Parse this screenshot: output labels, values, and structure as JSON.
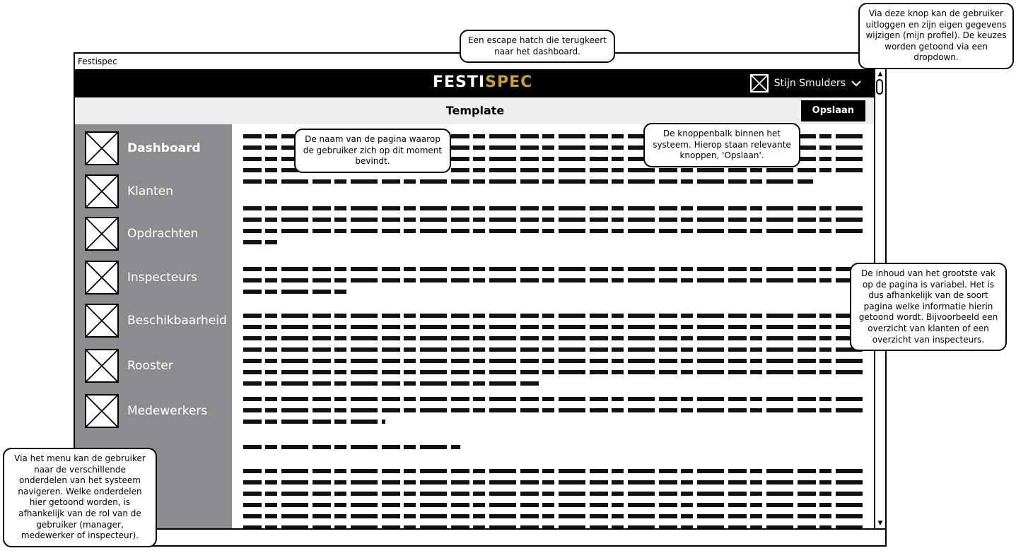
{
  "window": {
    "title": "Festispec"
  },
  "header": {
    "logo_part1": "FESTI",
    "logo_part2": "SPEC",
    "user_name": "Stijn Smulders",
    "user_icon": "image-placeholder-icon",
    "dropdown_icon": "chevron-down-icon"
  },
  "toolbar": {
    "page_title": "Template",
    "save_label": "Opslaan"
  },
  "sidebar": {
    "items": [
      {
        "label": "Dashboard",
        "icon": "image-placeholder-icon",
        "active": true
      },
      {
        "label": "Klanten",
        "icon": "image-placeholder-icon"
      },
      {
        "label": "Opdrachten",
        "icon": "image-placeholder-icon"
      },
      {
        "label": "Inspecteurs",
        "icon": "image-placeholder-icon"
      },
      {
        "label": "Beschikbaarheid",
        "icon": "image-placeholder-icon"
      },
      {
        "label": "Rooster",
        "icon": "image-placeholder-icon"
      },
      {
        "label": "Medewerkers",
        "icon": "image-placeholder-icon"
      }
    ]
  },
  "callouts": {
    "escape_hatch": "Een escape hatch die terugkeert naar het dashboard.",
    "user_menu": "Via deze knop kan de gebruiker uitloggen en zijn eigen gegevens wijzigen (mijn profiel). De keuzes worden getoond via een dropdown.",
    "page_name": "De naam van de pagina waarop de gebruiker zich op dit moment bevindt.",
    "button_bar": "De knoppenbalk binnen het systeem. Hierop staan relevante knoppen, 'Opslaan'.",
    "content_area": "De inhoud van het grootste vak op de pagina is variabel. Het is dus afhankelijk van de soort pagina welke informatie hierin getoond wordt. Bijvoorbeeld een overzicht van klanten of een overzicht van inspecteurs.",
    "menu": "Via het menu kan de gebruiker naar de verschillende onderdelen van het systeem navigeren. Welke onderdelen hier getoond worden, is afhankelijk van de rol van de gebruiker (manager, medewerker of inspecteur)."
  },
  "colors": {
    "header_bg": "#000000",
    "logo_accent": "#c9a227",
    "sidebar_bg": "#8c8c8e",
    "toolbar_bg": "#eeeeee"
  }
}
